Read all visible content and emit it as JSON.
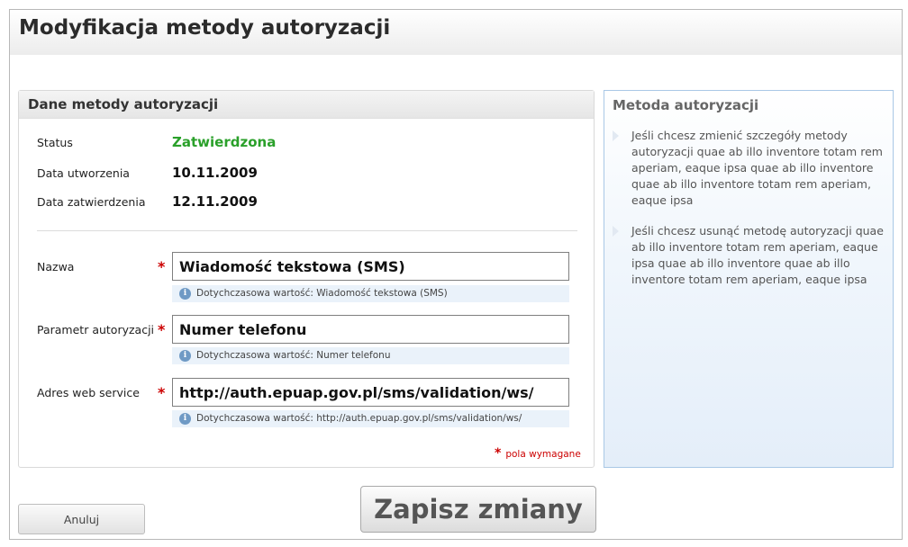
{
  "page": {
    "title": "Modyfikacja metody autoryzacji"
  },
  "details": {
    "section_title": "Dane metody autoryzacji",
    "status_label": "Status",
    "status_value": "Zatwierdzona",
    "created_label": "Data utworzenia",
    "created_value": "10.11.2009",
    "approved_label": "Data zatwierdzenia",
    "approved_value": "12.11.2009"
  },
  "form": {
    "name_label": "Nazwa",
    "name_value": "Wiadomość tekstowa (SMS)",
    "name_hint": "Dotychczasowa wartość: Wiadomość tekstowa (SMS)",
    "param_label": "Parametr autoryzacji",
    "param_value": "Numer telefonu",
    "param_hint": "Dotychczasowa wartość: Numer telefonu",
    "ws_label": "Adres web service",
    "ws_value": "http://auth.epuap.gov.pl/sms/validation/ws/",
    "ws_hint": "Dotychczasowa wartość: http://auth.epuap.gov.pl/sms/validation/ws/",
    "required_star": "*",
    "required_note": "pola wymagane"
  },
  "help": {
    "title": "Metoda autoryzacji",
    "paragraphs": [
      "Jeśli chcesz zmienić szczegóły metody autoryzacji quae ab illo inventore totam rem aperiam, eaque ipsa quae ab illo inventore quae ab illo inventore totam rem aperiam, eaque ipsa",
      "Jeśli chcesz usunąć metodę autoryzacji quae ab illo inventore totam rem aperiam, eaque ipsa quae ab illo inventore quae ab illo inventore totam rem aperiam, eaque ipsa"
    ]
  },
  "buttons": {
    "cancel": "Anuluj",
    "save": "Zapisz zmiany"
  },
  "icons": {
    "hint": "info-icon",
    "help_bullet": "arrow-right-icon"
  },
  "colors": {
    "status_ok": "#2aa02a",
    "required": "#cc0000",
    "help_border": "#a9c8e6",
    "hint_bg": "#eaf2fa"
  }
}
